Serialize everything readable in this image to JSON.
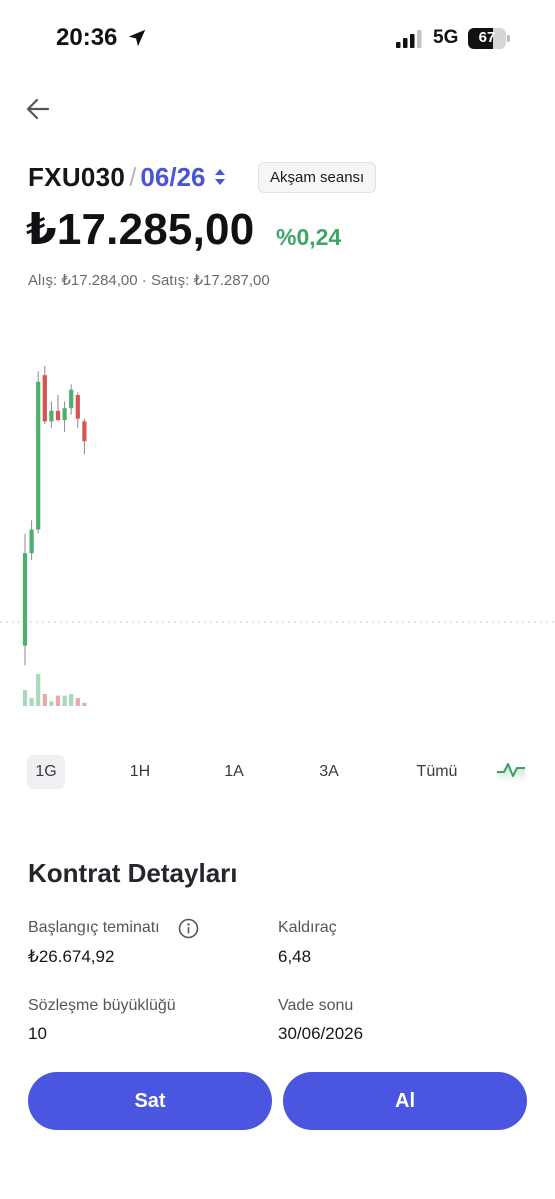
{
  "status_bar": {
    "time": "20:36",
    "network": "5G",
    "battery_level": 67,
    "battery_text": "67"
  },
  "header": {
    "symbol": "FXU030",
    "separator": "/",
    "contract_month": "06/26",
    "session_badge": "Akşam seansı"
  },
  "quote": {
    "price": "₺17.285,00",
    "change": "%0,24",
    "bid_ask": "Alış: ₺17.284,00 · Satış: ₺17.287,00"
  },
  "colors": {
    "accent": "#4a55e0",
    "up": "#4caf6e",
    "down": "#d9534f",
    "change_positive": "#43a468"
  },
  "chart_data": {
    "type": "candlestick",
    "candles": [
      {
        "o": 17100,
        "h": 17185,
        "l": 17085,
        "c": 17170,
        "dir": "up"
      },
      {
        "o": 17170,
        "h": 17195,
        "l": 17165,
        "c": 17188,
        "dir": "up"
      },
      {
        "o": 17188,
        "h": 17308,
        "l": 17185,
        "c": 17300,
        "dir": "up"
      },
      {
        "o": 17305,
        "h": 17312,
        "l": 17268,
        "c": 17270,
        "dir": "down"
      },
      {
        "o": 17270,
        "h": 17285,
        "l": 17265,
        "c": 17278,
        "dir": "up"
      },
      {
        "o": 17278,
        "h": 17290,
        "l": 17270,
        "c": 17271,
        "dir": "down"
      },
      {
        "o": 17271,
        "h": 17285,
        "l": 17262,
        "c": 17280,
        "dir": "up"
      },
      {
        "o": 17280,
        "h": 17298,
        "l": 17275,
        "c": 17294,
        "dir": "up"
      },
      {
        "o": 17290,
        "h": 17292,
        "l": 17265,
        "c": 17272,
        "dir": "down"
      },
      {
        "o": 17270,
        "h": 17272,
        "l": 17245,
        "c": 17255,
        "dir": "down"
      }
    ],
    "volumes": [
      2,
      1,
      4,
      1.5,
      0.6,
      1.3,
      1.3,
      1.5,
      1.0,
      0.4
    ],
    "grid": false
  },
  "range_tabs": {
    "active": "1G",
    "items": [
      "1G",
      "1H",
      "1A",
      "3A",
      "Tümü"
    ]
  },
  "chart_type_icon": "line-chart-icon",
  "details": {
    "title": "Kontrat Detayları",
    "initial_margin_label": "Başlangıç teminatı",
    "initial_margin_value": "₺26.674,92",
    "leverage_label": "Kaldıraç",
    "leverage_value": "6,48",
    "contract_size_label": "Sözleşme büyüklüğü",
    "contract_size_value": "10",
    "expiry_label": "Vade sonu",
    "expiry_value": "30/06/2026"
  },
  "actions": {
    "sell_label": "Sat",
    "buy_label": "Al"
  }
}
